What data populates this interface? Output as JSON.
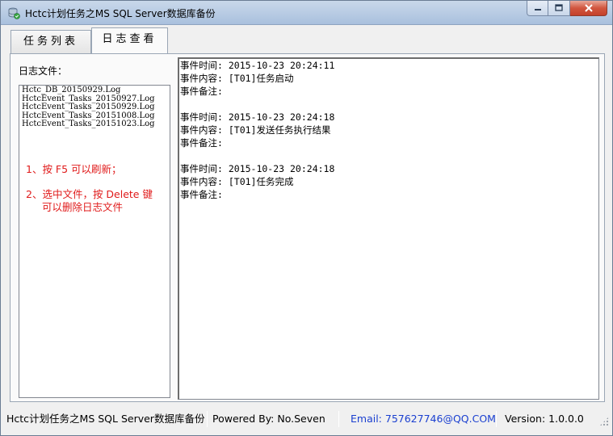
{
  "window": {
    "title": "Hctc计划任务之MS SQL Server数据库备份"
  },
  "tabs": [
    {
      "label": "任务列表",
      "active": false
    },
    {
      "label": "日志查看",
      "active": true
    }
  ],
  "log_panel": {
    "files_label": "日志文件：",
    "files": [
      "Hctc_DB_20150929.Log",
      "HctcEvent_Tasks_20150927.Log",
      "HctcEvent_Tasks_20150929.Log",
      "HctcEvent_Tasks_20151008.Log",
      "HctcEvent_Tasks_20151023.Log"
    ],
    "hints": {
      "line1": "1、按 F5 可以刷新；",
      "line2": "2、选中文件，按 Delete 键",
      "line3": "可以删除日志文件"
    },
    "entries": [
      {
        "time": "事件时间: 2015-10-23 20:24:11",
        "content": "事件内容: [T01]任务启动",
        "note": "事件备注:"
      },
      {
        "time": "事件时间: 2015-10-23 20:24:18",
        "content": "事件内容: [T01]发送任务执行结果",
        "note": "事件备注:"
      },
      {
        "time": "事件时间: 2015-10-23 20:24:18",
        "content": "事件内容: [T01]任务完成",
        "note": "事件备注:"
      }
    ]
  },
  "statusbar": {
    "app_name": "Hctc计划任务之MS SQL Server数据库备份",
    "powered_by": "Powered By: No.Seven",
    "email": "Email: 757627746@QQ.COM",
    "version": "Version: 1.0.0.0"
  },
  "colors": {
    "hint_red": "#e01a1a",
    "email_blue": "#1a3fd0",
    "close_red": "#c4412b"
  },
  "icons": {
    "app": "database-backup-icon",
    "minimize": "minimize-icon",
    "maximize": "maximize-icon",
    "close": "close-icon",
    "grip": "resize-grip-icon"
  }
}
